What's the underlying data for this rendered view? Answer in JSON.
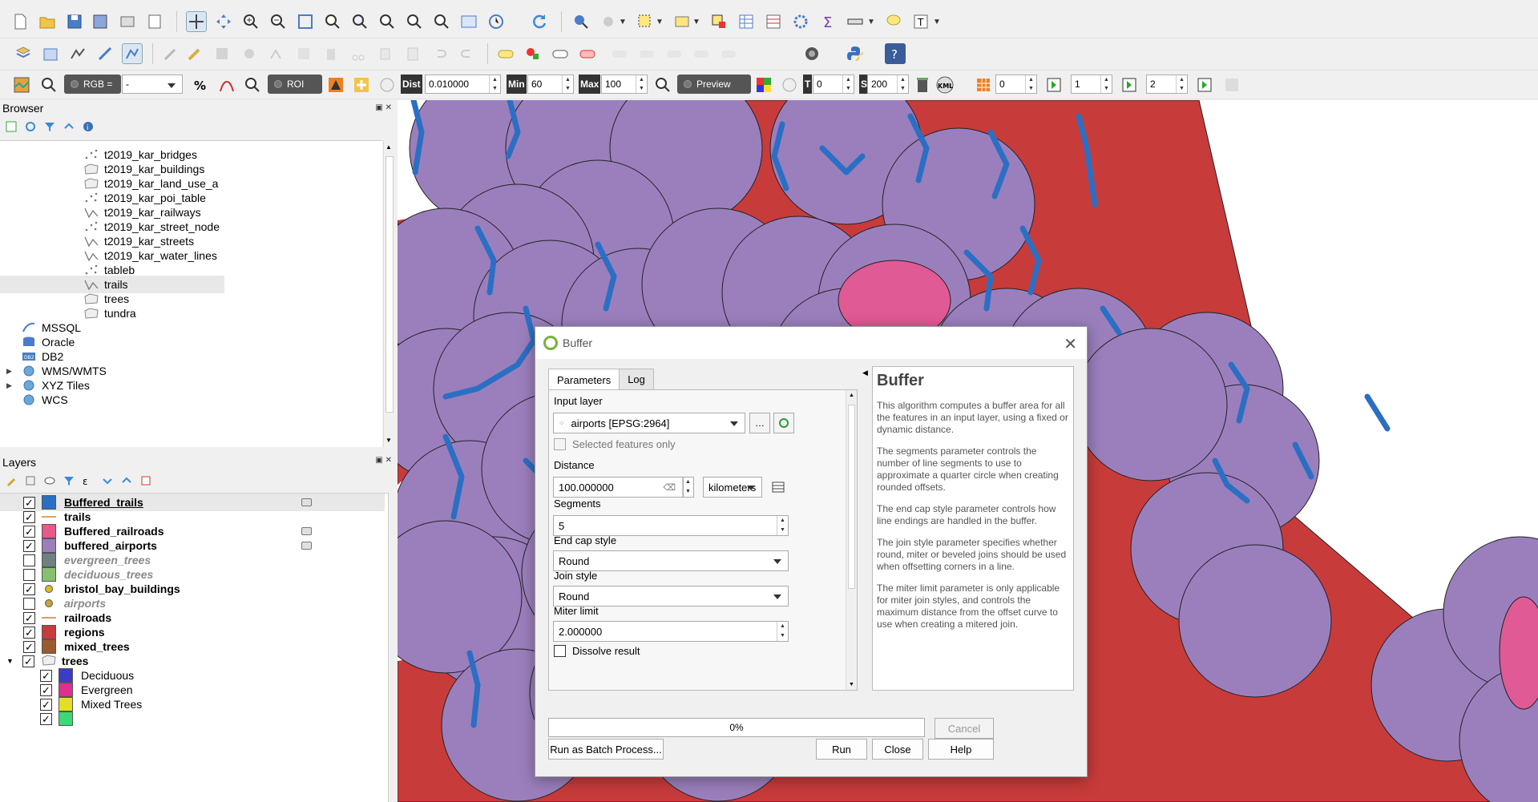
{
  "browser_panel": {
    "title": "Browser",
    "items": [
      {
        "label": "t2019_kar_bridges",
        "icon": "point-layer-icon"
      },
      {
        "label": "t2019_kar_buildings",
        "icon": "polygon-layer-icon"
      },
      {
        "label": "t2019_kar_land_use_a",
        "icon": "polygon-layer-icon"
      },
      {
        "label": "t2019_kar_poi_table",
        "icon": "point-layer-icon"
      },
      {
        "label": "t2019_kar_railways",
        "icon": "line-layer-icon"
      },
      {
        "label": "t2019_kar_street_node",
        "icon": "point-layer-icon"
      },
      {
        "label": "t2019_kar_streets",
        "icon": "line-layer-icon"
      },
      {
        "label": "t2019_kar_water_lines",
        "icon": "line-layer-icon"
      },
      {
        "label": "tableb",
        "icon": "point-layer-icon"
      },
      {
        "label": "trails",
        "icon": "line-layer-icon"
      },
      {
        "label": "trees",
        "icon": "polygon-layer-icon"
      },
      {
        "label": "tundra",
        "icon": "polygon-layer-icon"
      }
    ],
    "providers": [
      {
        "label": "MSSQL",
        "icon": "mssql-icon",
        "expand": false
      },
      {
        "label": "Oracle",
        "icon": "oracle-icon",
        "expand": false
      },
      {
        "label": "DB2",
        "icon": "db2-icon",
        "expand": false
      },
      {
        "label": "WMS/WMTS",
        "icon": "wms-globe-icon",
        "expand": true
      },
      {
        "label": "XYZ Tiles",
        "icon": "xyz-globe-icon",
        "expand": true
      },
      {
        "label": "WCS",
        "icon": "wcs-globe-icon",
        "expand": false
      }
    ]
  },
  "layers_panel": {
    "title": "Layers",
    "items": [
      {
        "label": "Buffered_trails",
        "checked": true,
        "swatch": "#2b6fc4",
        "style": "bold-underline",
        "edit": true
      },
      {
        "label": "trails",
        "checked": true,
        "swatch": "line:#e0a060",
        "style": "bold",
        "edit": false
      },
      {
        "label": "Buffered_railroads",
        "checked": true,
        "swatch": "#e8588c",
        "style": "bold",
        "edit": true
      },
      {
        "label": "buffered_airports",
        "checked": true,
        "swatch": "#9b7fbd",
        "style": "bold",
        "edit": true
      },
      {
        "label": "evergreen_trees",
        "checked": false,
        "swatch": "#6f8082",
        "style": "italic",
        "edit": false
      },
      {
        "label": "deciduous_trees",
        "checked": false,
        "swatch": "#86c06e",
        "style": "italic",
        "edit": false
      },
      {
        "label": "bristol_bay_buildings",
        "checked": true,
        "swatch": "dot:#d4c020",
        "style": "bold",
        "edit": false
      },
      {
        "label": "airports",
        "checked": false,
        "swatch": "dot:#c8a43c",
        "style": "italic",
        "edit": false
      },
      {
        "label": "railroads",
        "checked": true,
        "swatch": "line:#d4a060",
        "style": "bold",
        "edit": false
      },
      {
        "label": "regions",
        "checked": true,
        "swatch": "#c83b3b",
        "style": "bold",
        "edit": false
      },
      {
        "label": "mixed_trees",
        "checked": true,
        "swatch": "#9a5a30",
        "style": "bold",
        "edit": false
      },
      {
        "label": "trees",
        "checked": true,
        "swatch": "polygon-icon",
        "style": "bold",
        "edit": false,
        "group": true
      }
    ],
    "sub_items": [
      {
        "label": "Deciduous",
        "swatch": "#3c3cc8"
      },
      {
        "label": "Evergreen",
        "swatch": "#e0308c"
      },
      {
        "label": "Mixed Trees",
        "swatch": "#e4e020"
      },
      {
        "label": "",
        "swatch": "#3cd878"
      }
    ]
  },
  "toolbar3": {
    "rgb_label": "RGB =",
    "rgb_value": "-",
    "roi_label": "ROI",
    "dist_label": "Dist",
    "dist_value": "0.010000",
    "min_label": "Min",
    "min_value": "60",
    "max_label": "Max",
    "max_value": "100",
    "preview_label": "Preview",
    "t_label": "T",
    "t_value": "0",
    "s_label": "S",
    "s_value": "200",
    "kml_label": "KML",
    "spin_a": "0",
    "spin_b": "1",
    "spin_c": "2"
  },
  "dialog": {
    "title": "Buffer",
    "tabs": [
      "Parameters",
      "Log"
    ],
    "input_layer_label": "Input layer",
    "input_layer_value": "airports [EPSG:2964]",
    "selected_only_label": "Selected features only",
    "distance_label": "Distance",
    "distance_value": "100.000000",
    "distance_unit": "kilometers",
    "segments_label": "Segments",
    "segments_value": "5",
    "end_cap_label": "End cap style",
    "end_cap_value": "Round",
    "join_style_label": "Join style",
    "join_style_value": "Round",
    "miter_label": "Miter limit",
    "miter_value": "2.000000",
    "dissolve_label": "Dissolve result",
    "help_title": "Buffer",
    "help_paragraphs": [
      "This algorithm computes a buffer area for all the features in an input layer, using a fixed or dynamic distance.",
      "The segments parameter controls the number of line segments to use to approximate a quarter circle when creating rounded offsets.",
      "The end cap style parameter controls how line endings are handled in the buffer.",
      "The join style parameter specifies whether round, miter or beveled joins should be used when offsetting corners in a line.",
      "The miter limit parameter is only applicable for miter join styles, and controls the maximum distance from the offset curve to use when creating a mitered join."
    ],
    "progress": "0%",
    "cancel_label": "Cancel",
    "batch_label": "Run as Batch Process...",
    "run_label": "Run",
    "close_label": "Close",
    "help_label": "Help"
  },
  "colors": {
    "regions": "#c83b3b",
    "buffers": "#9b7fbd",
    "trails": "#2b6fc4",
    "railroads": "#e05a95"
  }
}
